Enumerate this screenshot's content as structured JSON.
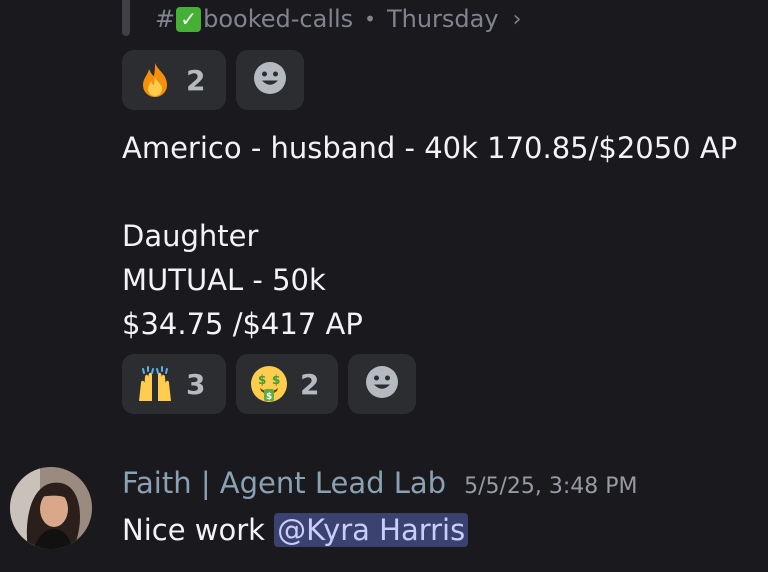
{
  "forwarded": {
    "hash": "#",
    "check_glyph": "✓",
    "channel_name": "booked-calls",
    "separator": "•",
    "day": "Thursday",
    "chevron": "›"
  },
  "reactions_row1": [
    {
      "emoji": "fire-icon",
      "count": "2"
    }
  ],
  "message": {
    "line1": "Americo - husband - 40k 170.85/$2050 AP",
    "line2": "Daughter",
    "line3": "MUTUAL - 50k",
    "line4": "$34.75 /$417 AP"
  },
  "reactions_row2": [
    {
      "emoji": "raising-hands-icon",
      "count": "3"
    },
    {
      "emoji": "money-mouth-face-icon",
      "count": "2"
    }
  ],
  "reply": {
    "author": "Faith | Agent Lead Lab",
    "timestamp": "5/5/25, 3:48 PM",
    "text_prefix": "Nice work ",
    "mention": "@Kyra Harris"
  },
  "colors": {
    "background": "#1a1a1e",
    "reaction_bg": "#2b2d31",
    "mention_bg": "#3c4270",
    "mention_text": "#c9cdfb",
    "author": "#8aa0b3"
  }
}
